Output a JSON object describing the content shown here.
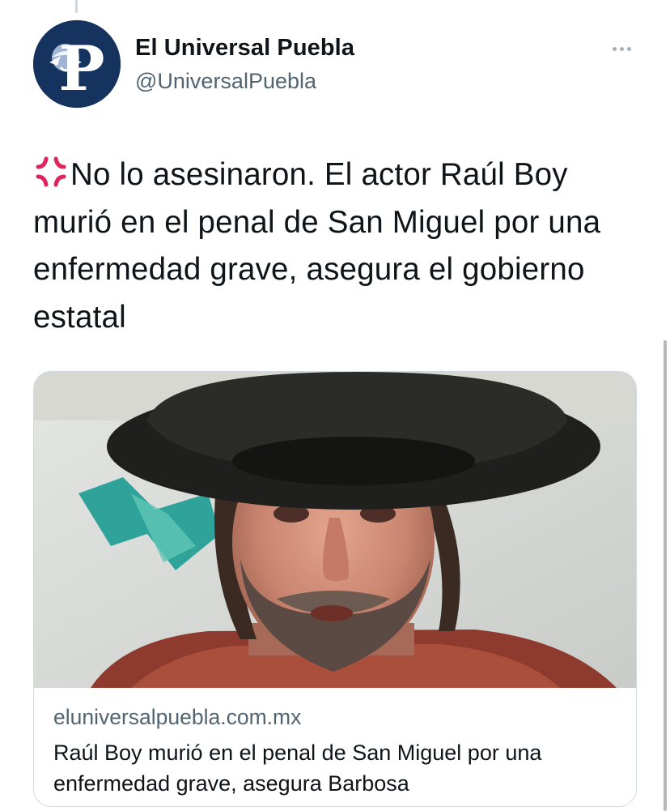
{
  "tweet": {
    "author": {
      "name": "El Universal Puebla",
      "handle": "@UniversalPuebla"
    },
    "text": "No lo asesinaron. El actor Raúl Boy murió en el penal de San Miguel por una enfermedad grave, asegura el gobierno estatal",
    "leading_emoji": "anger-symbol-icon",
    "link_card": {
      "domain": "eluniversalpuebla.com.mx",
      "title": "Raúl Boy murió en el penal de San Miguel por una enfermedad grave, asegura Barbosa"
    }
  },
  "colors": {
    "text_primary": "#0f1419",
    "text_secondary": "#536471",
    "border": "#cfd9de",
    "avatar_bg": "#15335e",
    "emoji_red": "#e0245e"
  }
}
